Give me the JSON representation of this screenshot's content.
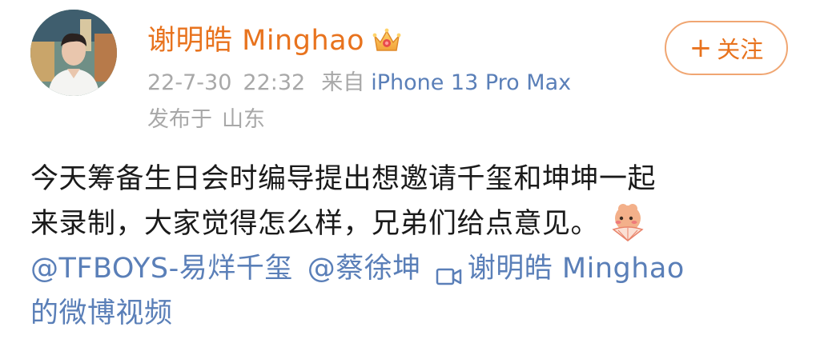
{
  "user": {
    "name": "谢明皓 Minghao",
    "verified_badge": "crown-badge-icon",
    "avatar": "user-avatar"
  },
  "post_meta": {
    "date": "22-7-30",
    "time": "22:32",
    "from_label": "来自",
    "device": "iPhone 13 Pro Max",
    "location_label": "发布于",
    "location": "山东"
  },
  "follow_button": {
    "plus": "+",
    "label": "关注"
  },
  "post": {
    "line1": "今天筹备生日会时编导提出想邀请千玺和坤坤一起",
    "line2": "来录制，大家觉得怎么样，兄弟们给点意见。",
    "emoji": "shy-fan-emoji",
    "mention1": "@TFBOYS-易烊千玺",
    "mention2": "@蔡徐坤",
    "video_link_part1": "谢明皓 Minghao",
    "video_link_part2": "的微博视频"
  },
  "colors": {
    "brand_orange": "#e8731e",
    "link_blue": "#5a7fb8",
    "meta_gray": "#a8a8a8",
    "button_border": "#f0a672"
  }
}
